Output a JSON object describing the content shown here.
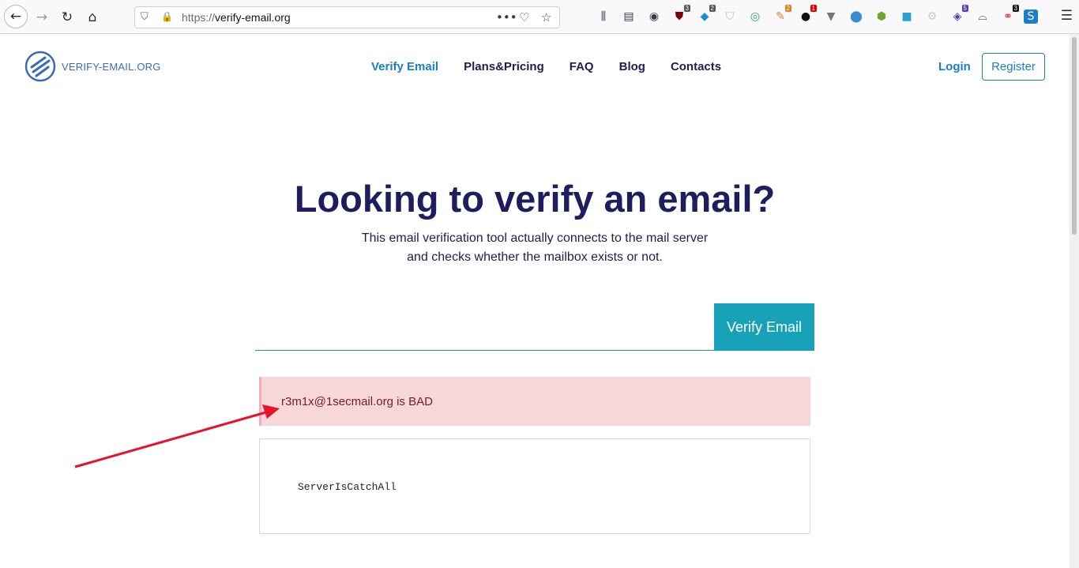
{
  "browser": {
    "url_protocol": "https://",
    "url_host": "verify-email.org",
    "extension_badges": [
      "3",
      "2",
      "2",
      "1",
      "5",
      "3"
    ]
  },
  "site": {
    "logo_text": "VERIFY-EMAIL.ORG",
    "nav": [
      {
        "label": "Verify Email",
        "active": true
      },
      {
        "label": "Plans&Pricing",
        "active": false
      },
      {
        "label": "FAQ",
        "active": false
      },
      {
        "label": "Blog",
        "active": false
      },
      {
        "label": "Contacts",
        "active": false
      }
    ],
    "login_label": "Login",
    "register_label": "Register"
  },
  "hero": {
    "title_prefix": "Looking to ",
    "title_bold": "verify an email",
    "title_suffix": "?",
    "subtitle_line1": "This email verification tool actually connects to the mail server",
    "subtitle_line2": "and checks whether the mailbox exists or not."
  },
  "form": {
    "input_value": "",
    "button_label": "Verify Email"
  },
  "result": {
    "alert_text": "r3m1x@1secmail.org is BAD",
    "detail_text": "ServerIsCatchAll"
  },
  "colors": {
    "accent": "#17a2b8",
    "alert_bg": "#f8d7da",
    "alert_text": "#721c24",
    "annotation_arrow": "#e8122a"
  }
}
